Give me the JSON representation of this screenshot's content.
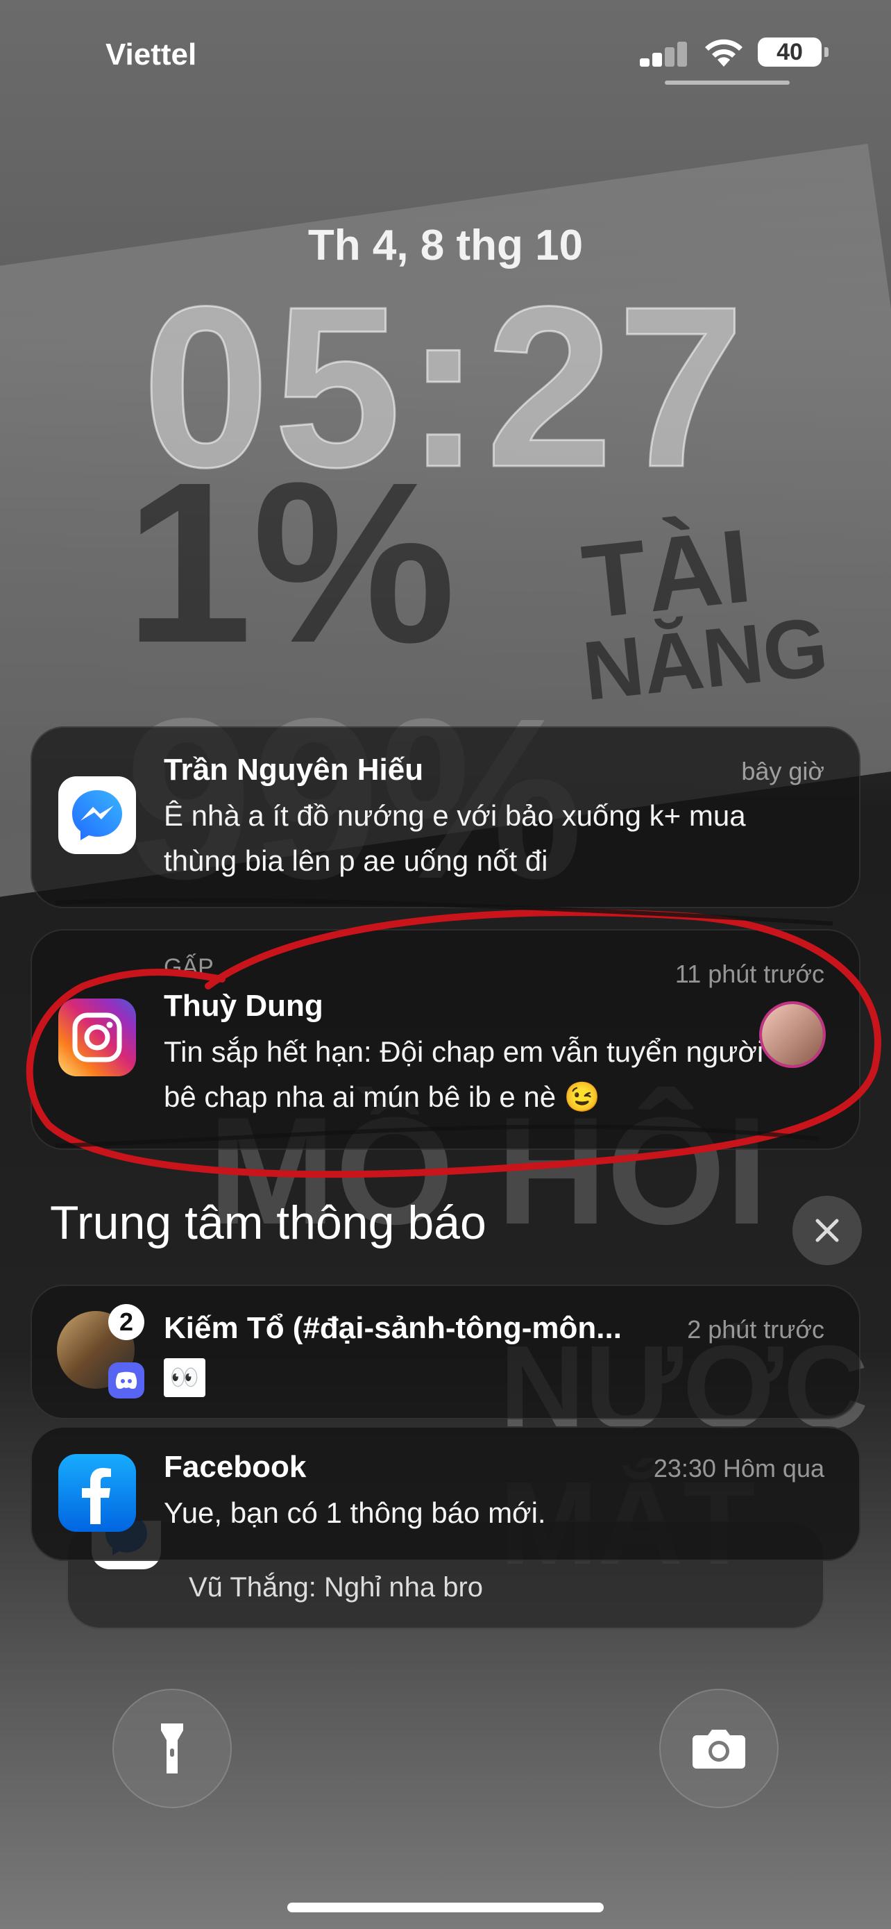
{
  "status_bar": {
    "carrier": "Viettel",
    "battery": "40"
  },
  "lock": {
    "date": "Th 4, 8 thg 10",
    "time": "05:27"
  },
  "notifications": [
    {
      "app": "Messenger",
      "title": "Trần Nguyên Hiếu",
      "time": "bây giờ",
      "body": "Ê nhà a ít đồ nướng e với bảo xuống k+ mua thùng bia lên p ae uống nốt đi"
    },
    {
      "app": "Instagram",
      "tag": "GẤP",
      "title": "Thuỳ Dung",
      "time": "11 phút trước",
      "body": "Tin sắp hết hạn: Đội chap em vẫn tuyển người bê chap nha ai mún bê ib e nè 😉"
    }
  ],
  "center": {
    "title": "Trung tâm thông báo",
    "items": [
      {
        "app": "Discord",
        "badge": "2",
        "title": "Kiếm Tổ (#đại-sảnh-tông-môn...",
        "time": "2 phút trước",
        "body": "👀"
      },
      {
        "app": "Facebook",
        "title": "Facebook",
        "time": "23:30 Hôm qua",
        "body": "Yue, bạn có 1 thông báo mới."
      },
      {
        "app": "Messenger",
        "body": "Vũ Thắng: Nghỉ nha bro"
      }
    ]
  }
}
